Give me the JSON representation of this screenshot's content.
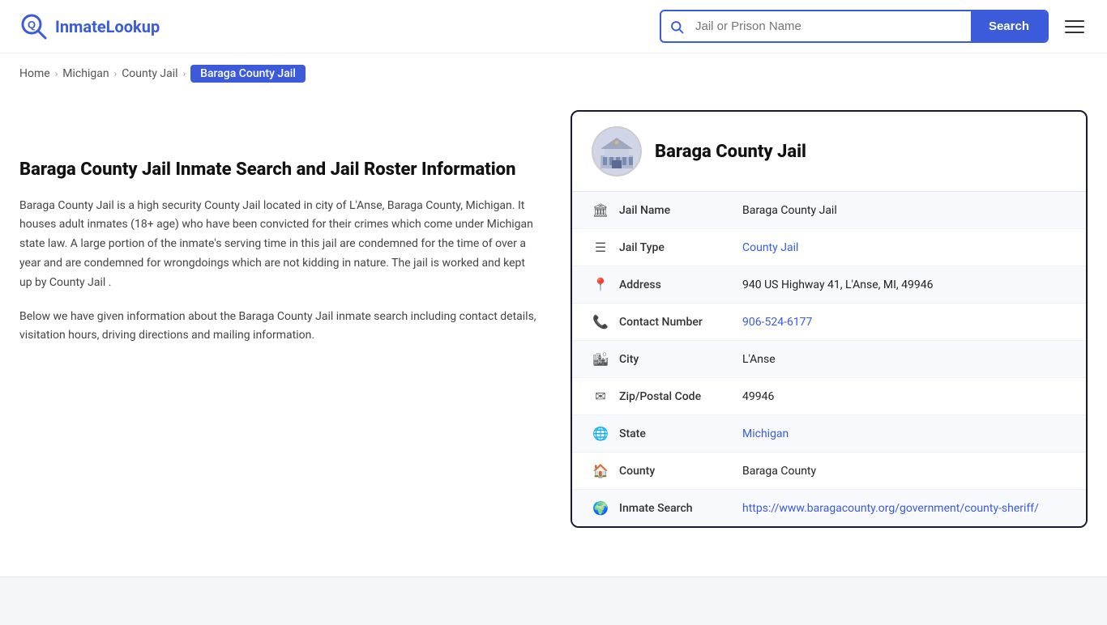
{
  "site": {
    "logo_text_start": "Inmate",
    "logo_text_end": "Lookup"
  },
  "header": {
    "search_placeholder": "Jail or Prison Name",
    "search_button_label": "Search"
  },
  "breadcrumb": {
    "items": [
      {
        "label": "Home",
        "href": "#"
      },
      {
        "label": "Michigan",
        "href": "#"
      },
      {
        "label": "County Jail",
        "href": "#"
      },
      {
        "label": "Baraga County Jail",
        "current": true
      }
    ]
  },
  "left": {
    "title": "Baraga County Jail Inmate Search and Jail Roster Information",
    "desc1": "Baraga County Jail is a high security County Jail located in city of L'Anse, Baraga County, Michigan. It houses adult inmates (18+ age) who have been convicted for their crimes which come under Michigan state law. A large portion of the inmate's serving time in this jail are condemned for the time of over a year and are condemned for wrongdoings which are not kidding in nature. The jail is worked and kept up by County Jail .",
    "desc2": "Below we have given information about the Baraga County Jail inmate search including contact details, visitation hours, driving directions and mailing information."
  },
  "card": {
    "jail_name": "Baraga County Jail",
    "rows": [
      {
        "id": "jail-name",
        "icon": "🏛",
        "label": "Jail Name",
        "value": "Baraga County Jail",
        "link": null
      },
      {
        "id": "jail-type",
        "icon": "☰",
        "label": "Jail Type",
        "value": "County Jail",
        "link": "#"
      },
      {
        "id": "address",
        "icon": "📍",
        "label": "Address",
        "value": "940 US Highway 41, L'Anse, MI, 49946",
        "link": null
      },
      {
        "id": "contact",
        "icon": "📞",
        "label": "Contact Number",
        "value": "906-524-6177",
        "link": "tel:906-524-6177"
      },
      {
        "id": "city",
        "icon": "🏙",
        "label": "City",
        "value": "L'Anse",
        "link": null
      },
      {
        "id": "zip",
        "icon": "✉",
        "label": "Zip/Postal Code",
        "value": "49946",
        "link": null
      },
      {
        "id": "state",
        "icon": "🌐",
        "label": "State",
        "value": "Michigan",
        "link": "#"
      },
      {
        "id": "county",
        "icon": "🏠",
        "label": "County",
        "value": "Baraga County",
        "link": null
      },
      {
        "id": "inmate-search",
        "icon": "🌍",
        "label": "Inmate Search",
        "value": "https://www.baragacounty.org/government/county-sheriff/",
        "link": "https://www.baragacounty.org/government/county-sheriff/"
      }
    ]
  }
}
